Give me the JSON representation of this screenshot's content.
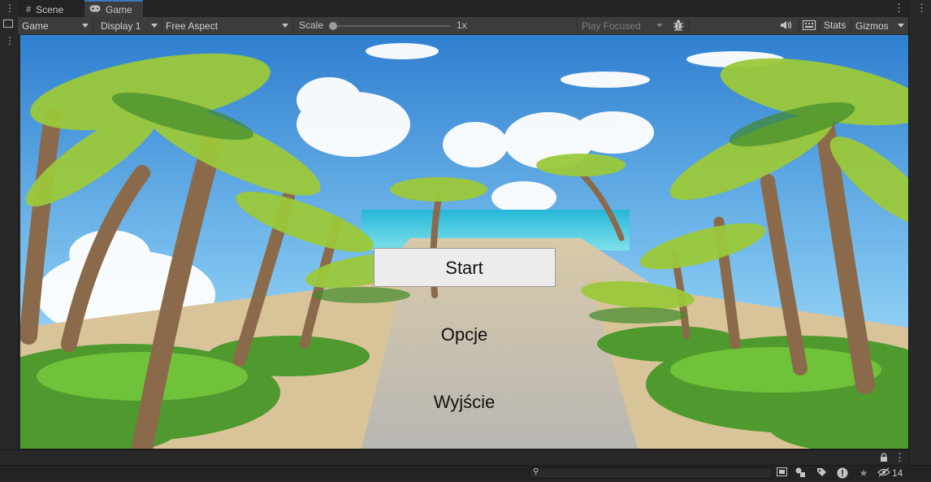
{
  "tabs": [
    {
      "label": "Scene",
      "icon": "grid-icon"
    },
    {
      "label": "Game",
      "icon": "gamepad-icon"
    }
  ],
  "toolbar": {
    "display_mode": "Game",
    "display": "Display 1",
    "aspect": "Free Aspect",
    "scale_label": "Scale",
    "scale_value": "1x",
    "scale_fraction": 0.0,
    "play_mode": "Play Focused",
    "stats_label": "Stats",
    "gizmos_label": "Gizmos"
  },
  "game_menu": {
    "start": "Start",
    "options": "Opcje",
    "exit": "Wyjście"
  },
  "status": {
    "hidden_count": "14"
  },
  "colors": {
    "editor_bg": "#282828",
    "toolbar_bg": "#3c3c3c",
    "tab_accent": "#3a79bb",
    "button_bg": "#ececec"
  }
}
